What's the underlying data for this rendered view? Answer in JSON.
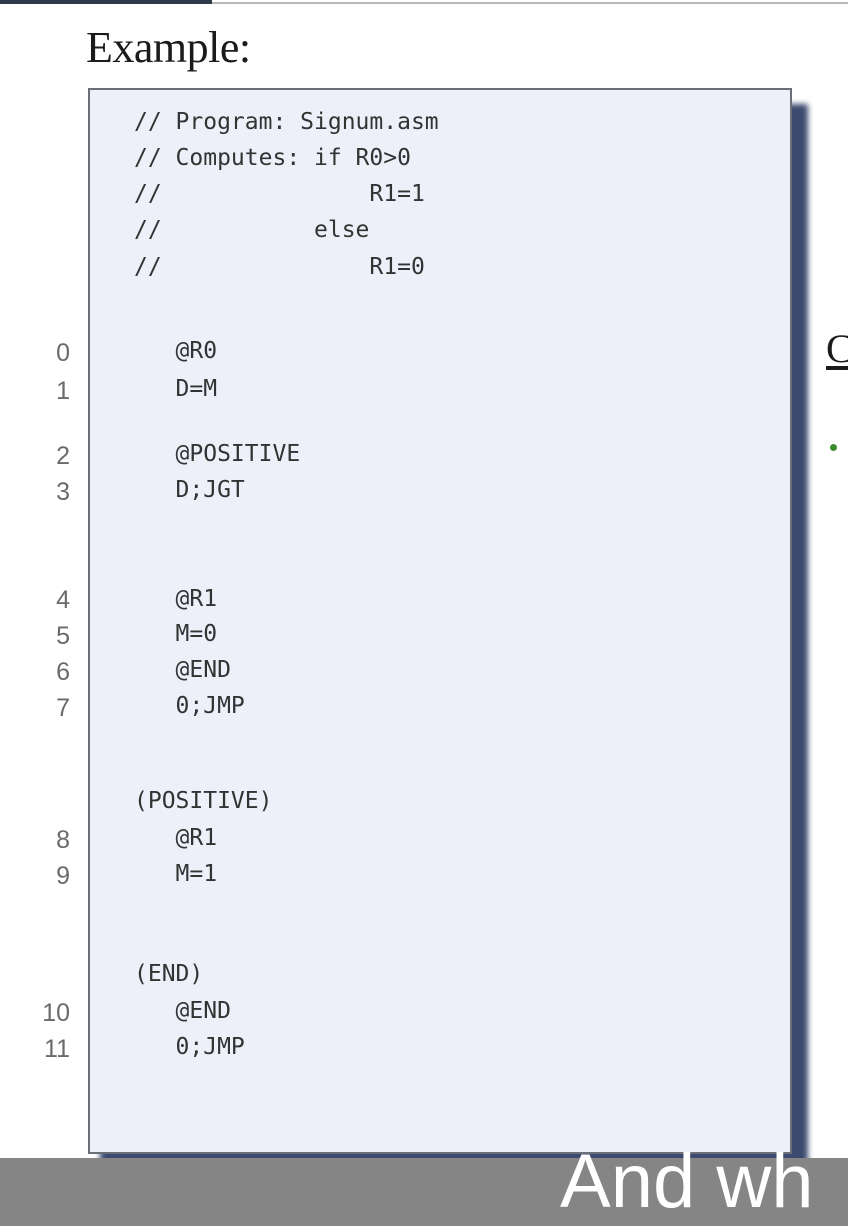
{
  "slide": {
    "heading": "Example:",
    "side_letter": "C",
    "caption": "And wh"
  },
  "code": {
    "comments": [
      "// Program: Signum.asm",
      "// Computes: if R0>0",
      "//               R1=1",
      "//           else",
      "//               R1=0"
    ],
    "lines": [
      {
        "num": "0",
        "text": "   @R0"
      },
      {
        "num": "1",
        "text": "   D=M"
      },
      {
        "num": "2",
        "text": "   @POSITIVE"
      },
      {
        "num": "3",
        "text": "   D;JGT"
      },
      {
        "num": "4",
        "text": "   @R1"
      },
      {
        "num": "5",
        "text": "   M=0"
      },
      {
        "num": "6",
        "text": "   @END"
      },
      {
        "num": "7",
        "text": "   0;JMP"
      },
      {
        "num": "",
        "text": "(POSITIVE)"
      },
      {
        "num": "8",
        "text": "   @R1"
      },
      {
        "num": "9",
        "text": "   M=1"
      },
      {
        "num": "",
        "text": "(END)"
      },
      {
        "num": "10",
        "text": "   @END"
      },
      {
        "num": "11",
        "text": "   0;JMP"
      }
    ]
  },
  "colors": {
    "code_background": "#eef0f9",
    "caption_bar": "#858585",
    "bullet": "#3c8a2e"
  }
}
